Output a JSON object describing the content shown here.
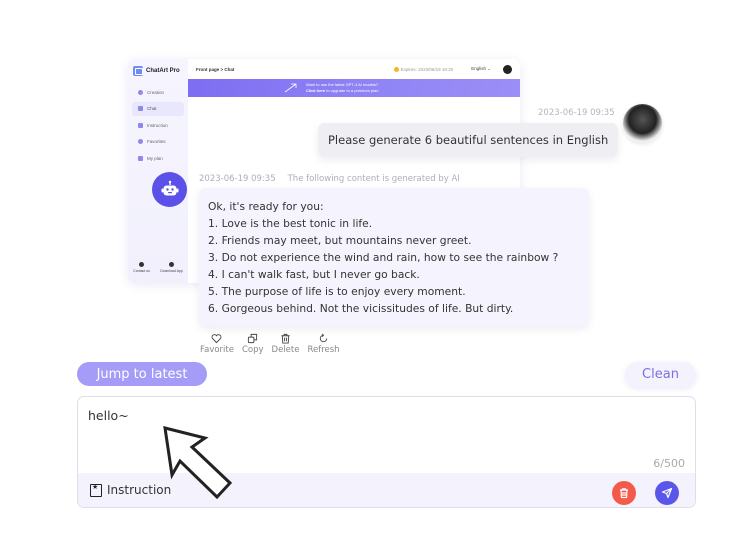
{
  "mini_app": {
    "brand": "ChatArt Pro",
    "nav": [
      {
        "label": "Creation",
        "active": false
      },
      {
        "label": "Chat",
        "active": true
      },
      {
        "label": "Instruction",
        "active": false
      },
      {
        "label": "Favorites",
        "active": false
      },
      {
        "label": "My plan",
        "active": false
      }
    ],
    "footer": [
      {
        "label": "Contact us"
      },
      {
        "label": "Download App"
      }
    ],
    "breadcrumb": "Front page > Chat",
    "expiry": "Expires: 2023/06/19 18:20",
    "language": "English",
    "banner": {
      "line1": "Want to use the latest GPT-4 AI models?",
      "link": "Click here",
      "line2": " to upgrade to a premium plan"
    }
  },
  "chat": {
    "user_message": {
      "timestamp": "2023-06-19 09:35",
      "text": "Please generate 6 beautiful sentences in English"
    },
    "ai_message": {
      "timestamp": "2023-06-19 09:35",
      "notice": "The following content is generated by AI",
      "lines": [
        "Ok, it's ready for you:",
        "1. Love is the best tonic in life.",
        "2. Friends may meet, but mountains never greet.",
        "3. Do not experience the wind and rain, how to see the rainbow ?",
        "4. I can't walk fast, but I never go back.",
        "5. The purpose of life is to enjoy every moment.",
        "6. Gorgeous behind. Not the vicissitudes of life. But dirty."
      ]
    },
    "actions": [
      {
        "label": "Favorite",
        "icon": "heart-icon"
      },
      {
        "label": "Copy",
        "icon": "copy-icon"
      },
      {
        "label": "Delete",
        "icon": "trash-icon"
      },
      {
        "label": "Refresh",
        "icon": "refresh-icon"
      }
    ]
  },
  "controls": {
    "jump_label": "Jump to latest",
    "clean_label": "Clean"
  },
  "composer": {
    "value": "hello~",
    "counter": "6/500",
    "instruction_label": "Instruction"
  },
  "colors": {
    "accent": "#5b56ea",
    "accent_light": "#a49cf6",
    "danger": "#f35a4a",
    "bubble_ai": "#f5f4fe",
    "bubble_user": "#efeff3"
  }
}
